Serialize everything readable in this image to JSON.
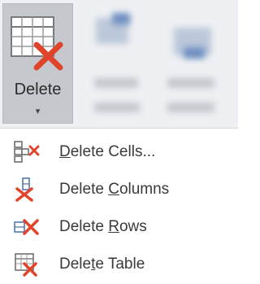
{
  "ribbon": {
    "delete_button": {
      "label": "Delete",
      "arrow": "▾"
    }
  },
  "menu": {
    "items": [
      {
        "pre": "",
        "mn": "D",
        "post": "elete Cells...",
        "icon": "delete-cells-icon"
      },
      {
        "pre": "Delete ",
        "mn": "C",
        "post": "olumns",
        "icon": "delete-columns-icon"
      },
      {
        "pre": "Delete ",
        "mn": "R",
        "post": "ows",
        "icon": "delete-rows-icon"
      },
      {
        "pre": "Dele",
        "mn": "t",
        "post": "e Table",
        "icon": "delete-table-icon"
      }
    ]
  },
  "colors": {
    "accent_red": "#e0452c",
    "grid_blue": "#4a6fa5",
    "button_pressed": "#c5c8cd"
  }
}
